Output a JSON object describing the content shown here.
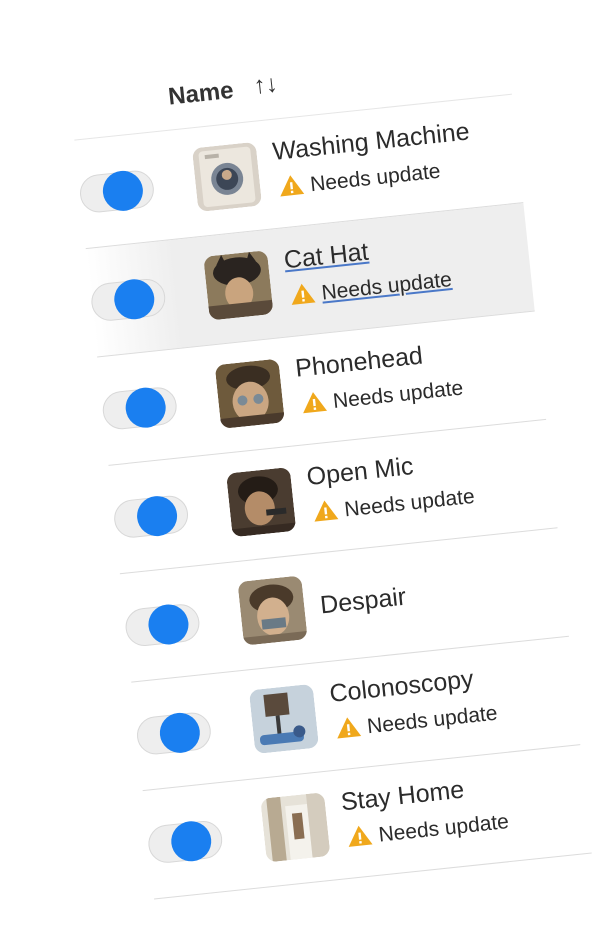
{
  "header": {
    "title": "Name",
    "sort_icon_glyph": "↑↓",
    "sort_icon_name": "sort-icon"
  },
  "colors": {
    "accent": "#1a7ff0",
    "warning": "#f0a81c",
    "text": "#2b2b2b"
  },
  "items": [
    {
      "title": "Washing Machine",
      "status": "Needs update",
      "enabled": true,
      "thumbnail": "washing-machine-thumbnail"
    },
    {
      "title": "Cat Hat",
      "status": "Needs update",
      "enabled": true,
      "thumbnail": "cat-hat-thumbnail"
    },
    {
      "title": "Phonehead",
      "status": "Needs update",
      "enabled": true,
      "thumbnail": "phonehead-thumbnail"
    },
    {
      "title": "Open Mic",
      "status": "Needs update",
      "enabled": true,
      "thumbnail": "open-mic-thumbnail"
    },
    {
      "title": "Despair",
      "status": "",
      "enabled": true,
      "thumbnail": "despair-thumbnail"
    },
    {
      "title": "Colonoscopy",
      "status": "Needs update",
      "enabled": true,
      "thumbnail": "colonoscopy-thumbnail"
    },
    {
      "title": "Stay Home",
      "status": "Needs update",
      "enabled": true,
      "thumbnail": "stay-home-thumbnail"
    }
  ]
}
